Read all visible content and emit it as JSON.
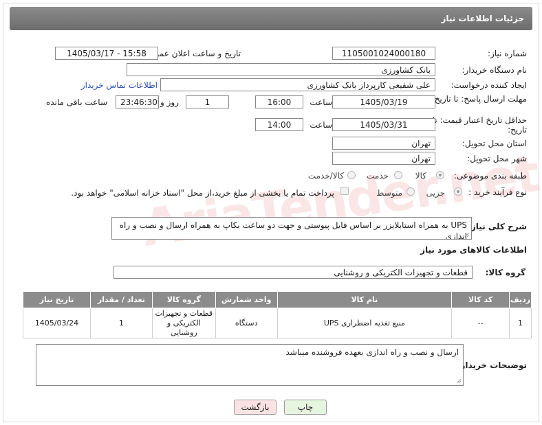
{
  "header": {
    "title": "جزئیات اطلاعات نیاز"
  },
  "form": {
    "need_number_label": "شماره نیاز:",
    "need_number": "1105001024000180",
    "announce_label": "تاریخ و ساعت اعلان عمومی:",
    "announce_value": "1405/03/17 - 15:58",
    "buyer_org_label": "نام دستگاه خریدار:",
    "buyer_org": "بانک کشاورزی",
    "creator_label": "ایجاد کننده درخواست:",
    "creator": "علی شفیعی کارپرداز بانک کشاورزی",
    "contact_link": "اطلاعات تماس خریدار",
    "deadline_label": "مهلت ارسال پاسخ: تا تاریخ:",
    "deadline_date": "1405/03/19",
    "time_label": "ساعت",
    "deadline_time": "16:00",
    "days_value": "1",
    "days_label": "روز و",
    "remaining_time": "23:46:30",
    "remaining_label": "ساعت باقی مانده",
    "validity_label": "حداقل تاریخ اعتبار قیمت: تا تاریخ:",
    "validity_date": "1405/03/31",
    "validity_time": "14:00",
    "province_label": "استان محل تحویل:",
    "province": "تهران",
    "city_label": "شهر محل تحویل:",
    "city": "تهران",
    "category_label": "طبقه بندی موضوعی:",
    "category_options": [
      "کالا",
      "خدمت",
      "کالا/خدمت"
    ],
    "process_label": "نوع فرآیند خرید :",
    "process_options": [
      "جزیی",
      "متوسط"
    ],
    "payment_note": "پرداخت تمام یا بخشی از مبلغ خرید،از محل \"اسناد خزانه اسلامی\" خواهد بود."
  },
  "description": {
    "label": "شرح کلی نیاز:",
    "text": "UPS به همراه استابلایزر بر اساس فایل پیوستی و جهت دو ساعت بکاپ به همراه ارسال و نصب و راه اندازی"
  },
  "goods": {
    "section_title": "اطلاعات کالاهای مورد نیاز",
    "group_label": "گروه کالا:",
    "group_value": "قطعات و تجهیزات الکتریکی و روشنایی",
    "columns": [
      "ردیف",
      "کد کالا",
      "نام کالا",
      "واحد شمارش",
      "گروه کالا",
      "تعداد / مقدار",
      "تاریخ نیاز"
    ],
    "rows": [
      [
        "1",
        "--",
        "منبع تغذیه اضطراری UPS",
        "دستگاه",
        "قطعات و تجهیزات الکتریکی و روشنایی",
        "1",
        "1405/03/24"
      ]
    ]
  },
  "buyer_notes": {
    "label": "توضیحات خریدار:",
    "text": "ارسال و نصب و راه اندازی بعهده فروشنده میباشد"
  },
  "buttons": {
    "print": "چاپ",
    "back": "بازگشت"
  },
  "watermark": "AriaTender.net",
  "colors": {
    "header": "#7a7a7a",
    "link": "#2a4fb3",
    "back_btn": "#fbe3e3",
    "print_btn": "#e6f5e0"
  }
}
